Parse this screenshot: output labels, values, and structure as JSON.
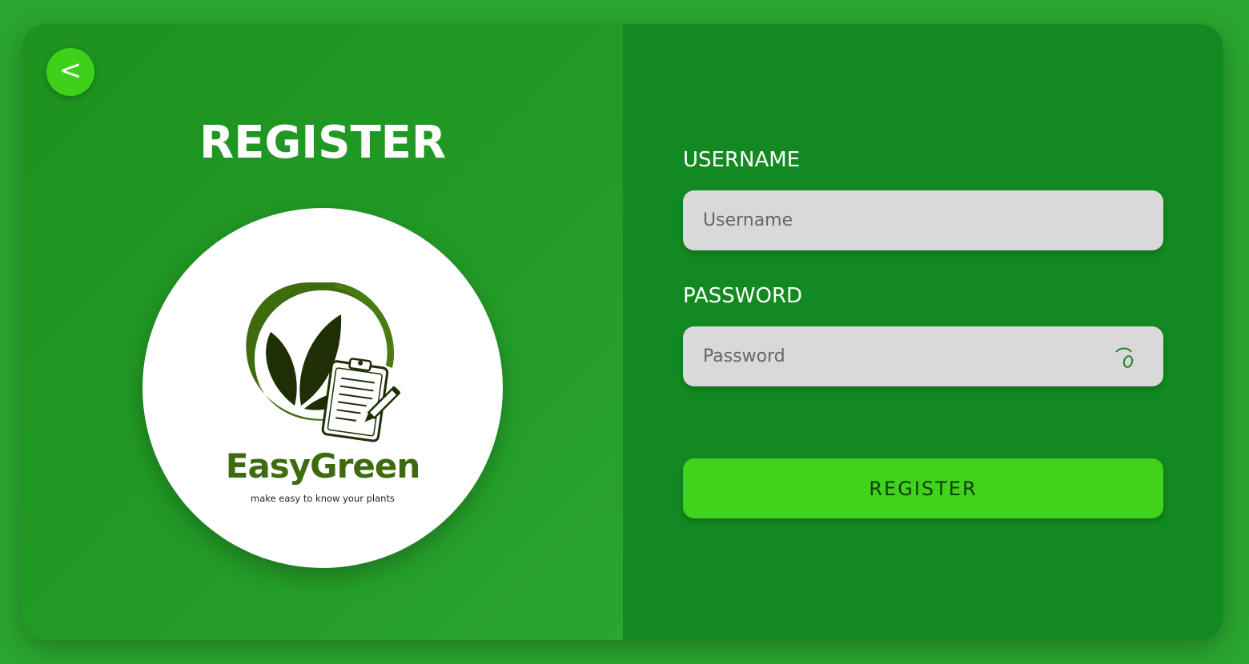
{
  "nav": {
    "back_label": "<"
  },
  "left": {
    "title": "REGISTER",
    "logo": {
      "brand": "EasyGreen",
      "tagline": "make easy to know your plants",
      "icon": "leaf-clipboard-logo"
    }
  },
  "form": {
    "username": {
      "label": "USERNAME",
      "placeholder": "Username",
      "value": ""
    },
    "password": {
      "label": "PASSWORD",
      "placeholder": "Password",
      "value": "",
      "toggle_icon": "eye-closed-icon"
    },
    "submit_label": "REGISTER"
  },
  "colors": {
    "background": "#2aa52f",
    "left_panel": "#1d921f",
    "right_panel": "#128a21",
    "accent": "#3fd31b",
    "input_bg": "#d9d9d9",
    "brand_green": "#3e6b0e"
  }
}
